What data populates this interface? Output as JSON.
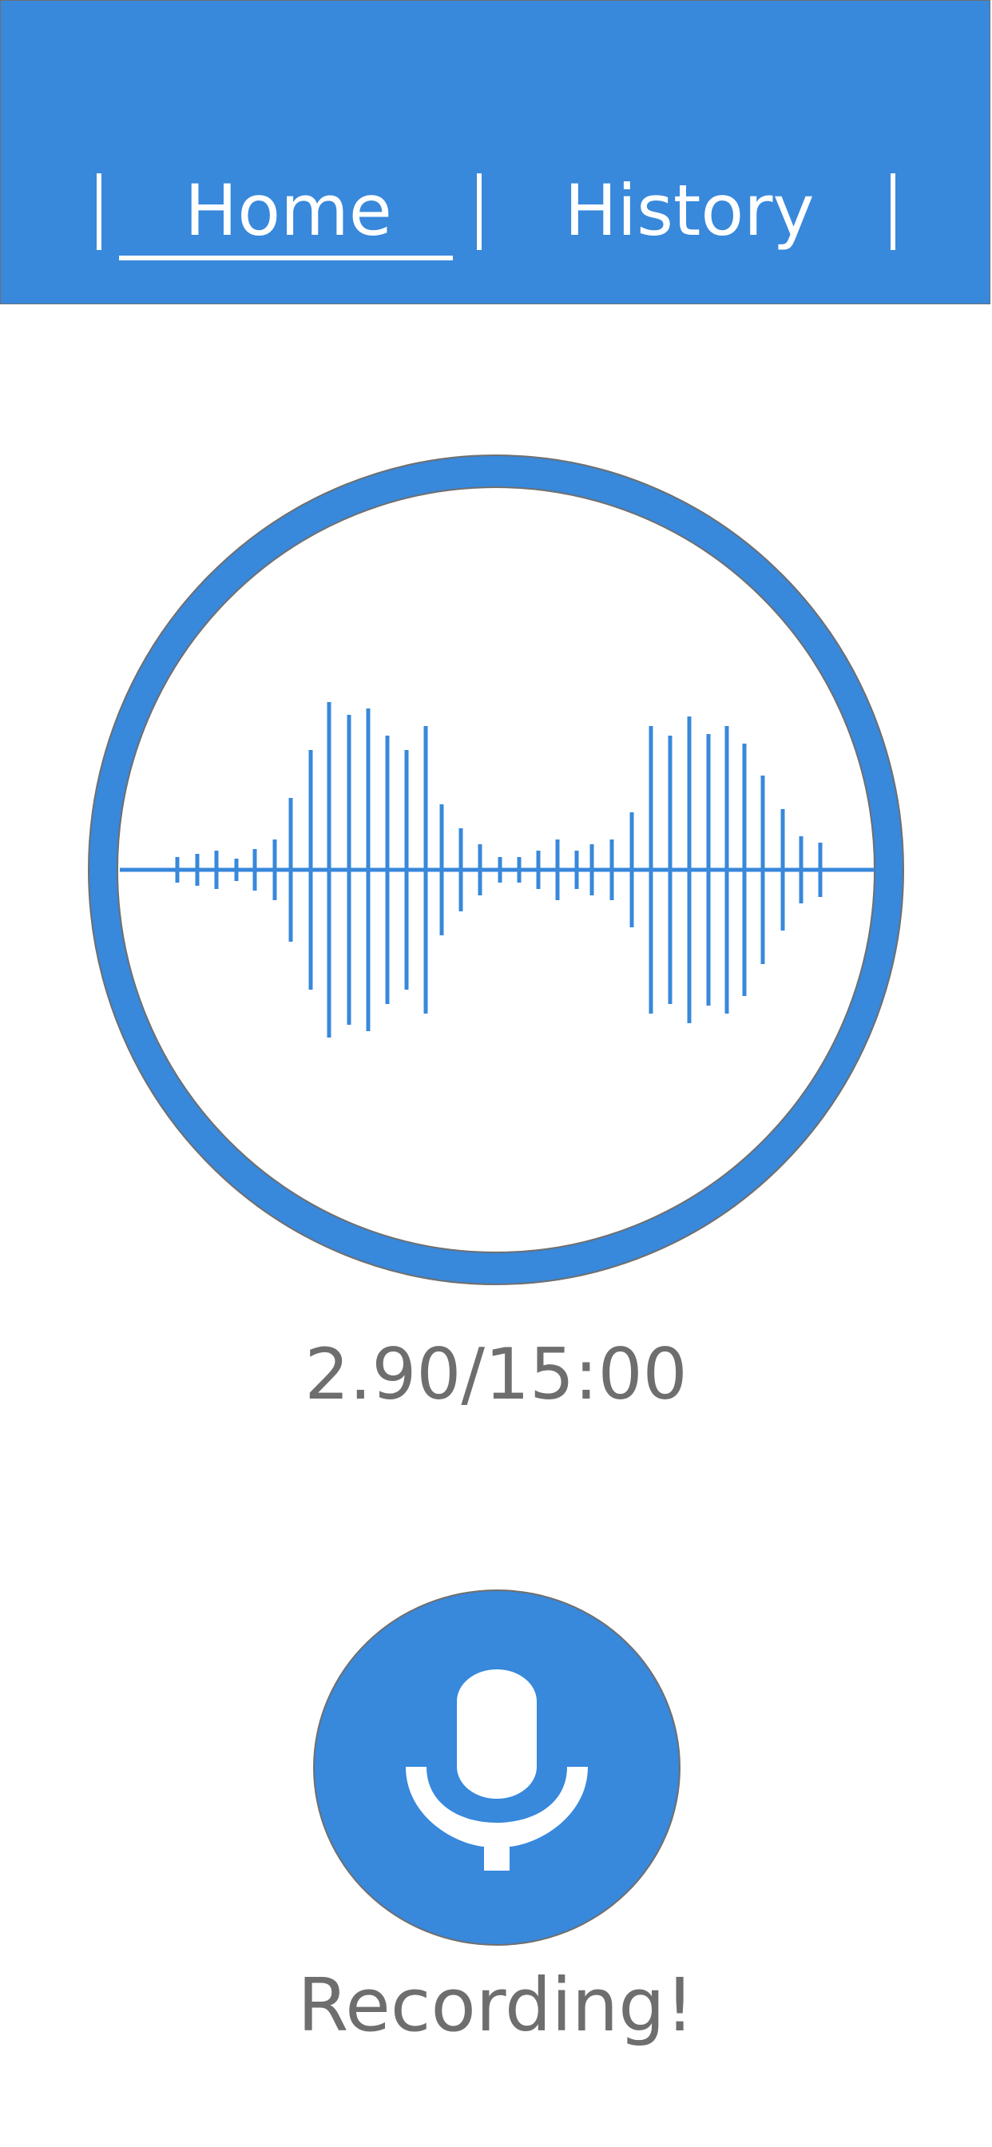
{
  "nav": {
    "tabs": [
      {
        "label": "Home",
        "active": true
      },
      {
        "label": "History",
        "active": false
      }
    ]
  },
  "recorder": {
    "elapsed": "2.90",
    "limit": "15:00",
    "timer_text": "2.90/15:00",
    "status": "Recording!"
  },
  "icons": {
    "record": "microphone-icon"
  },
  "colors": {
    "accent": "#3888db",
    "text_muted": "#6e6e6e",
    "white": "#ffffff"
  }
}
